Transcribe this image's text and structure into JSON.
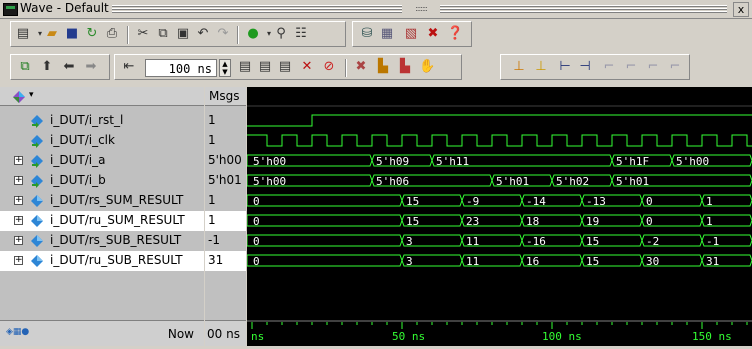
{
  "window": {
    "title": "Wave - Default",
    "close_label": "x",
    "grip_label": ":::::::"
  },
  "toolbar": {
    "row1_icons": [
      "new-file-icon",
      "dropdown-arrow-icon",
      "open-folder-icon",
      "save-icon",
      "reload-icon",
      "print-icon",
      "cut-icon",
      "copy-icon",
      "paste-icon",
      "undo-icon",
      "redo-icon",
      "add-icon",
      "dropdown-arrow-icon",
      "find-icon",
      "format-icon",
      "compile-icon",
      "list-icon",
      "breakpoint-icon",
      "help-icon"
    ],
    "row2_icons": [
      "layout-icon",
      "up-arrow-icon",
      "left-arrow-icon",
      "right-arrow-icon",
      "restart-icon",
      "run-icon",
      "continue-icon",
      "run-all-icon",
      "break-icon",
      "stop-icon",
      "wave-edit-icon",
      "bar-chart-icon",
      "bar-chart-2-icon",
      "hand-icon",
      "cursor-up-icon",
      "cursor-down-icon",
      "cursor-left-icon",
      "cursor-right-icon",
      "edge-1-icon",
      "edge-2-icon",
      "edge-3-icon"
    ],
    "zoom_value": "100 ns"
  },
  "signals_header": {
    "msgs_label": "Msgs"
  },
  "signals": [
    {
      "name": "i_DUT/i_rst_l",
      "value": "1",
      "expandable": false,
      "type": "input",
      "selected": false
    },
    {
      "name": "i_DUT/i_clk",
      "value": "1",
      "expandable": false,
      "type": "input",
      "selected": false
    },
    {
      "name": "i_DUT/i_a",
      "value": "5'h00",
      "expandable": true,
      "type": "input",
      "selected": false
    },
    {
      "name": "i_DUT/i_b",
      "value": "5'h01",
      "expandable": true,
      "type": "input",
      "selected": false
    },
    {
      "name": "i_DUT/rs_SUM_RESULT",
      "value": "1",
      "expandable": true,
      "type": "output",
      "selected": false
    },
    {
      "name": "i_DUT/ru_SUM_RESULT",
      "value": "1",
      "expandable": true,
      "type": "output",
      "selected": true
    },
    {
      "name": "i_DUT/rs_SUB_RESULT",
      "value": "-1",
      "expandable": true,
      "type": "output",
      "selected": false
    },
    {
      "name": "i_DUT/ru_SUB_RESULT",
      "value": "31",
      "expandable": true,
      "type": "output",
      "selected": true
    }
  ],
  "status": {
    "now_label": "Now",
    "now_value": "00 ns"
  },
  "waveform": {
    "timeline_labels": [
      "ns",
      "50 ns",
      "100 ns",
      "150 ns"
    ],
    "rst_high_from_ns": 20,
    "clk_period_ns": 10,
    "buses": [
      {
        "signal": "i_a",
        "segments": [
          {
            "start": 0,
            "label": "5'h00"
          },
          {
            "start": 40,
            "label": "5'h09"
          },
          {
            "start": 60,
            "label": "5'h11"
          },
          {
            "start": 120,
            "label": "5'h1F"
          },
          {
            "start": 140,
            "label": "5'h00"
          }
        ]
      },
      {
        "signal": "i_b",
        "segments": [
          {
            "start": 0,
            "label": "5'h00"
          },
          {
            "start": 40,
            "label": "5'h06"
          },
          {
            "start": 80,
            "label": "5'h01"
          },
          {
            "start": 100,
            "label": "5'h02"
          },
          {
            "start": 120,
            "label": "5'h01"
          }
        ]
      },
      {
        "signal": "rs_SUM_RESULT",
        "segments": [
          {
            "start": 0,
            "label": "0"
          },
          {
            "start": 50,
            "label": "15"
          },
          {
            "start": 70,
            "label": "-9"
          },
          {
            "start": 90,
            "label": "-14"
          },
          {
            "start": 110,
            "label": "-13"
          },
          {
            "start": 130,
            "label": "0"
          },
          {
            "start": 150,
            "label": "1"
          }
        ]
      },
      {
        "signal": "ru_SUM_RESULT",
        "segments": [
          {
            "start": 0,
            "label": "0"
          },
          {
            "start": 50,
            "label": "15"
          },
          {
            "start": 70,
            "label": "23"
          },
          {
            "start": 90,
            "label": "18"
          },
          {
            "start": 110,
            "label": "19"
          },
          {
            "start": 130,
            "label": "0"
          },
          {
            "start": 150,
            "label": "1"
          }
        ]
      },
      {
        "signal": "rs_SUB_RESULT",
        "segments": [
          {
            "start": 0,
            "label": "0"
          },
          {
            "start": 50,
            "label": "3"
          },
          {
            "start": 70,
            "label": "11"
          },
          {
            "start": 90,
            "label": "-16"
          },
          {
            "start": 110,
            "label": "15"
          },
          {
            "start": 130,
            "label": "-2"
          },
          {
            "start": 150,
            "label": "-1"
          }
        ]
      },
      {
        "signal": "ru_SUB_RESULT",
        "segments": [
          {
            "start": 0,
            "label": "0"
          },
          {
            "start": 50,
            "label": "3"
          },
          {
            "start": 70,
            "label": "11"
          },
          {
            "start": 90,
            "label": "16"
          },
          {
            "start": 110,
            "label": "15"
          },
          {
            "start": 130,
            "label": "30"
          },
          {
            "start": 150,
            "label": "31"
          }
        ]
      }
    ],
    "colors": {
      "wave": "#33ff33",
      "background": "#000000",
      "timeline": "#33ff33"
    }
  }
}
